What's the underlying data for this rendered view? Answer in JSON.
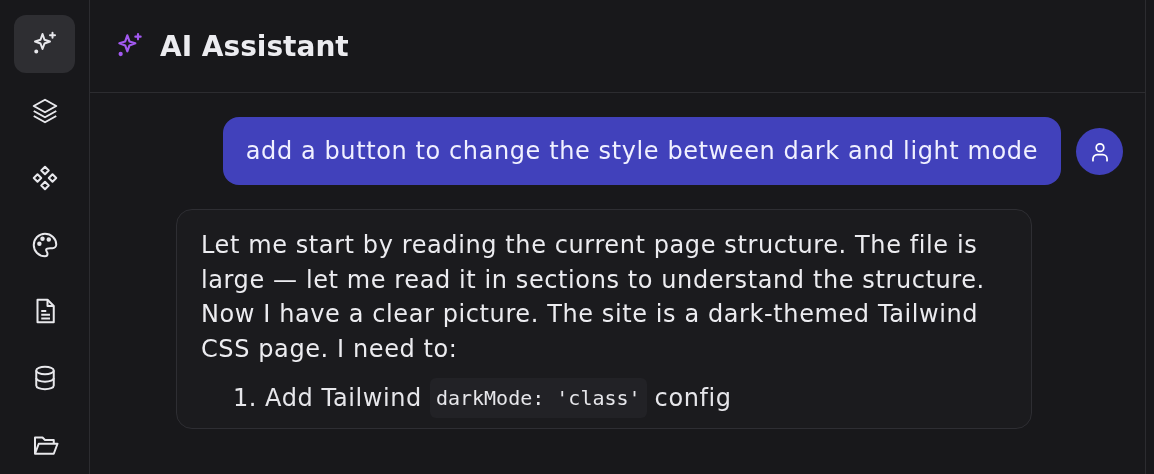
{
  "sidebar": {
    "items": [
      {
        "kind": "sparkles",
        "selected": true
      },
      {
        "kind": "layers",
        "selected": false
      },
      {
        "kind": "components",
        "selected": false
      },
      {
        "kind": "palette",
        "selected": false
      },
      {
        "kind": "document",
        "selected": false
      },
      {
        "kind": "database",
        "selected": false
      },
      {
        "kind": "folder",
        "selected": false
      }
    ]
  },
  "header": {
    "title": "AI Assistant"
  },
  "messages": [
    {
      "kind": "user",
      "text": "add a button to change the style between dark and light mode"
    },
    {
      "kind": "assistant",
      "paragraph": "Let me start by reading the current page structure. The file is large — let me read it in sections to understand the structure. Now I have a clear picture. The site is a dark-themed Tailwind CSS page. I need to:",
      "steps": [
        {
          "number": "1.",
          "text_before": "Add Tailwind",
          "code": "darkMode: 'class'",
          "text_after": "config"
        }
      ]
    }
  ]
}
